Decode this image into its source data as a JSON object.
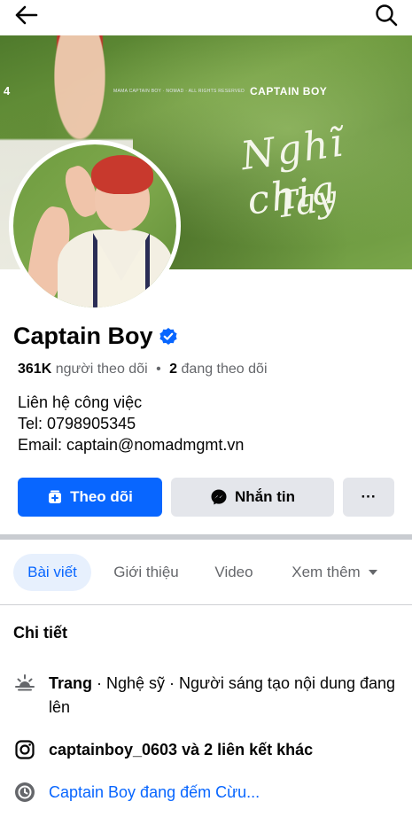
{
  "header": {
    "back_icon": "arrow-left-icon",
    "search_icon": "search-icon"
  },
  "cover": {
    "number": "4",
    "brand": "CAPTAIN BOY",
    "small_text": "MAMA CAPTAIN BOY · NOMAD · ALL RIGHTS RESERVED",
    "title_line1": "Nghĩ chia",
    "title_line2": "Tay"
  },
  "profile": {
    "name": "Captain Boy",
    "verified_icon": "verified-badge-icon",
    "followers_count": "361K",
    "followers_label": "người theo dõi",
    "separator": "•",
    "following_count": "2",
    "following_label": "đang theo dõi",
    "bio_line1": "Liên hệ công việc",
    "bio_line2": "Tel: 0798905345",
    "bio_line3": "Email: captain@nomadmgmt.vn"
  },
  "actions": {
    "follow_label": "Theo dõi",
    "message_label": "Nhắn tin",
    "more_label": "···"
  },
  "tabs": [
    {
      "label": "Bài viết",
      "active": true
    },
    {
      "label": "Giới thiệu",
      "active": false
    },
    {
      "label": "Video",
      "active": false
    },
    {
      "label": "Xem thêm",
      "active": false
    }
  ],
  "details": {
    "title": "Chi tiết",
    "page_type_bold": "Trang",
    "page_type_rest": " · Nghệ sỹ · Người sáng tạo nội dung đang lên",
    "links_bold": "captainboy_0603 và 2 liên kết khác",
    "countdown_text": "Captain Boy đang đếm Cừu..."
  },
  "colors": {
    "accent": "#0866ff",
    "button_gray": "#e4e6eb",
    "secondary_text": "#65676b",
    "tab_active_bg": "#e7f0fd"
  }
}
